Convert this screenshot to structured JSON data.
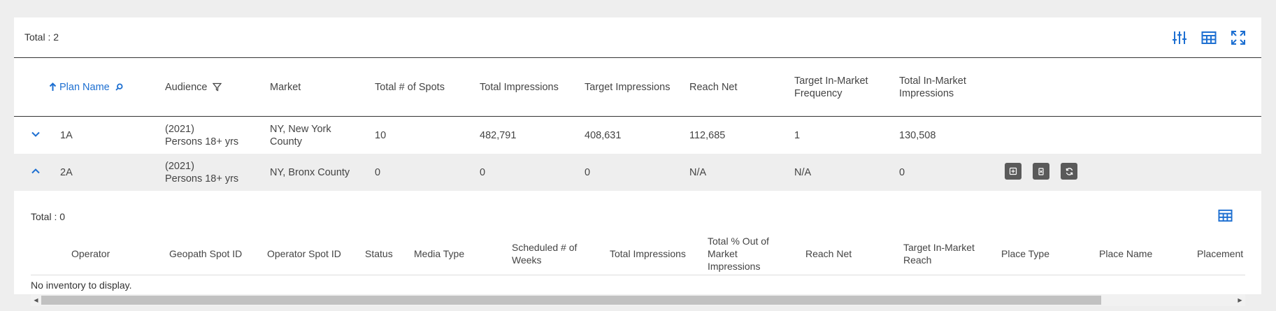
{
  "colors": {
    "accent": "#1d6fd1",
    "header_text": "#444444",
    "action_bg": "#5a5a5a"
  },
  "top": {
    "total_label": "Total : 2",
    "icons": [
      "sliders-icon",
      "table-columns-icon",
      "fullscreen-icon"
    ]
  },
  "table": {
    "headers": [
      "Plan Name",
      "Audience",
      "Market",
      "Total # of Spots",
      "Total Impressions",
      "Target Impressions",
      "Reach Net",
      "Target In-Market Frequency",
      "Total In-Market Impressions"
    ],
    "rows": [
      {
        "expanded": false,
        "plan_name": "1A",
        "audience_year": "(2021)",
        "audience": "Persons 18+ yrs",
        "market": "NY, New York County",
        "total_spots": "10",
        "total_impressions": "482,791",
        "target_impressions": "408,631",
        "reach_net": "112,685",
        "target_frequency": "1",
        "total_in_market_impressions": "130,508"
      },
      {
        "expanded": true,
        "plan_name": "2A",
        "audience_year": "(2021)",
        "audience": "Persons 18+ yrs",
        "market": "NY, Bronx County",
        "total_spots": "0",
        "total_impressions": "0",
        "target_impressions": "0",
        "reach_net": "N/A",
        "target_frequency": "N/A",
        "total_in_market_impressions": "0",
        "actions": [
          "add-icon",
          "delete-icon",
          "refresh-icon"
        ]
      }
    ]
  },
  "sub_table": {
    "total_label": "Total : 0",
    "headers": [
      "Operator",
      "Geopath Spot ID",
      "Operator Spot ID",
      "Status",
      "Media Type",
      "Scheduled # of Weeks",
      "Total Impressions",
      "Total % Out of Market Impressions",
      "Reach Net",
      "Target In-Market Reach",
      "Place Type",
      "Place Name",
      "Placement"
    ],
    "empty_message": "No inventory to display."
  }
}
